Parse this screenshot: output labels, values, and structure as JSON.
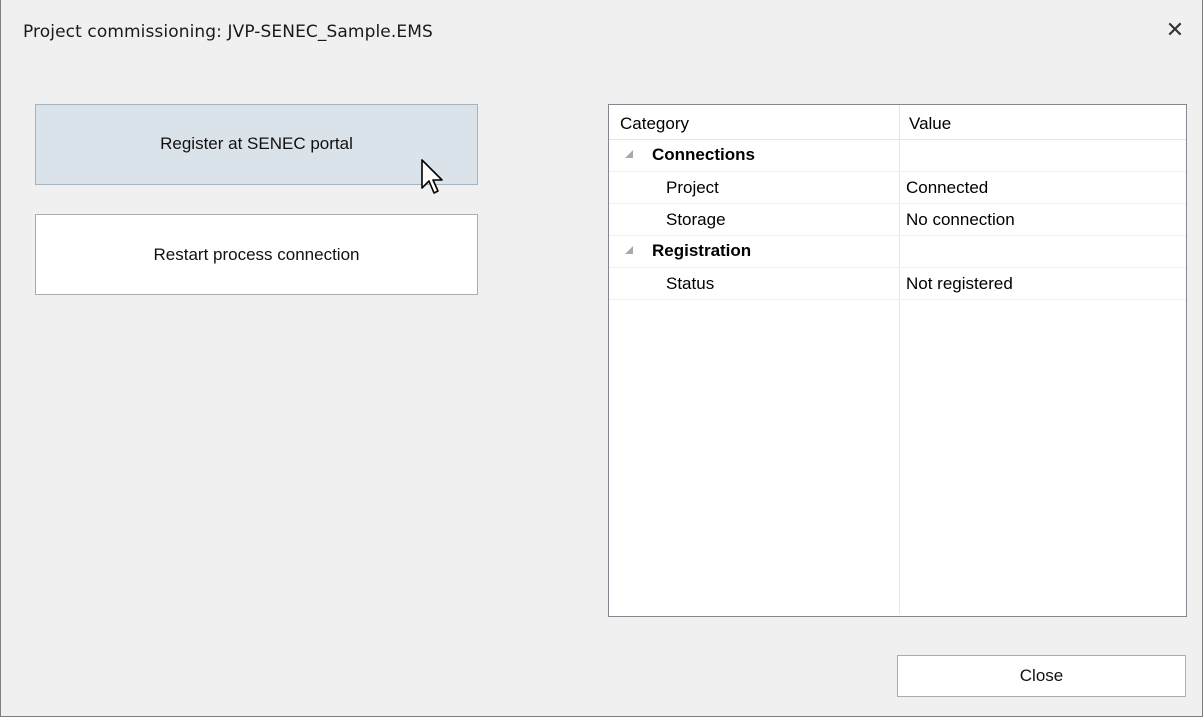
{
  "window": {
    "title": "Project commissioning: JVP-SENEC_Sample.EMS",
    "close_glyph": "✕"
  },
  "actions": {
    "register_label": "Register at SENEC portal",
    "restart_label": "Restart process connection",
    "close_label": "Close"
  },
  "grid": {
    "headers": {
      "category": "Category",
      "value": "Value"
    },
    "sections": [
      {
        "name": "Connections",
        "rows": [
          {
            "key": "Project",
            "value": "Connected"
          },
          {
            "key": "Storage",
            "value": "No connection"
          }
        ]
      },
      {
        "name": "Registration",
        "rows": [
          {
            "key": "Status",
            "value": "Not registered"
          }
        ]
      }
    ]
  },
  "icons": {
    "window_close": "close-icon",
    "expander": "collapse-triangle-icon",
    "cursor": "mouse-pointer-icon"
  },
  "colors": {
    "hover_button_bg": "#dbe3ea",
    "window_bg": "#f0f0f0",
    "grid_border": "#828790"
  }
}
